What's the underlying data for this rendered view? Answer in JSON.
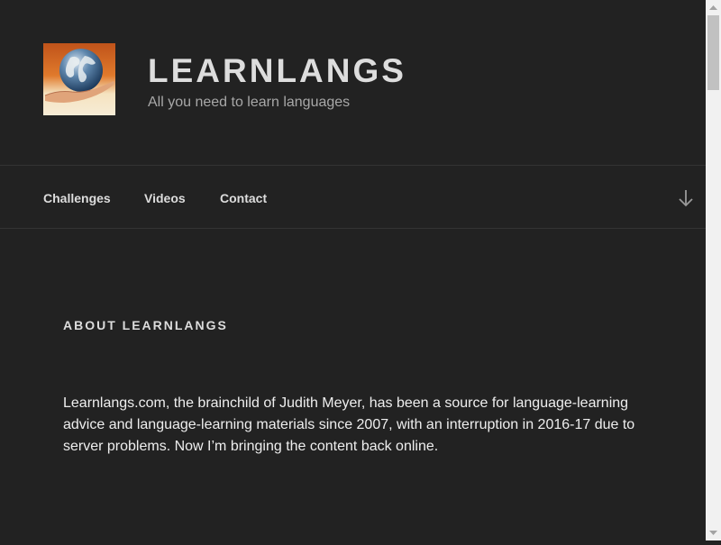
{
  "site": {
    "title": "LEARNLANGS",
    "tagline": "All you need to learn languages",
    "logo_icon": "globe-in-hand-icon"
  },
  "nav": {
    "items": [
      {
        "label": "Challenges"
      },
      {
        "label": "Videos"
      },
      {
        "label": "Contact"
      }
    ],
    "scroll_icon": "arrow-down-icon"
  },
  "content": {
    "heading": "ABOUT LEARNLANGS",
    "paragraph": "Learnlangs.com, the brainchild of Judith Meyer, has been a source for language-learning advice and language-learning materials since 2007, with an interruption in 2016-17 due to server problems. Now I’m bringing the content back online."
  },
  "colors": {
    "background": "#222222",
    "title": "#dddddd",
    "tagline": "#a8a8a8",
    "text": "#eeeeee"
  }
}
